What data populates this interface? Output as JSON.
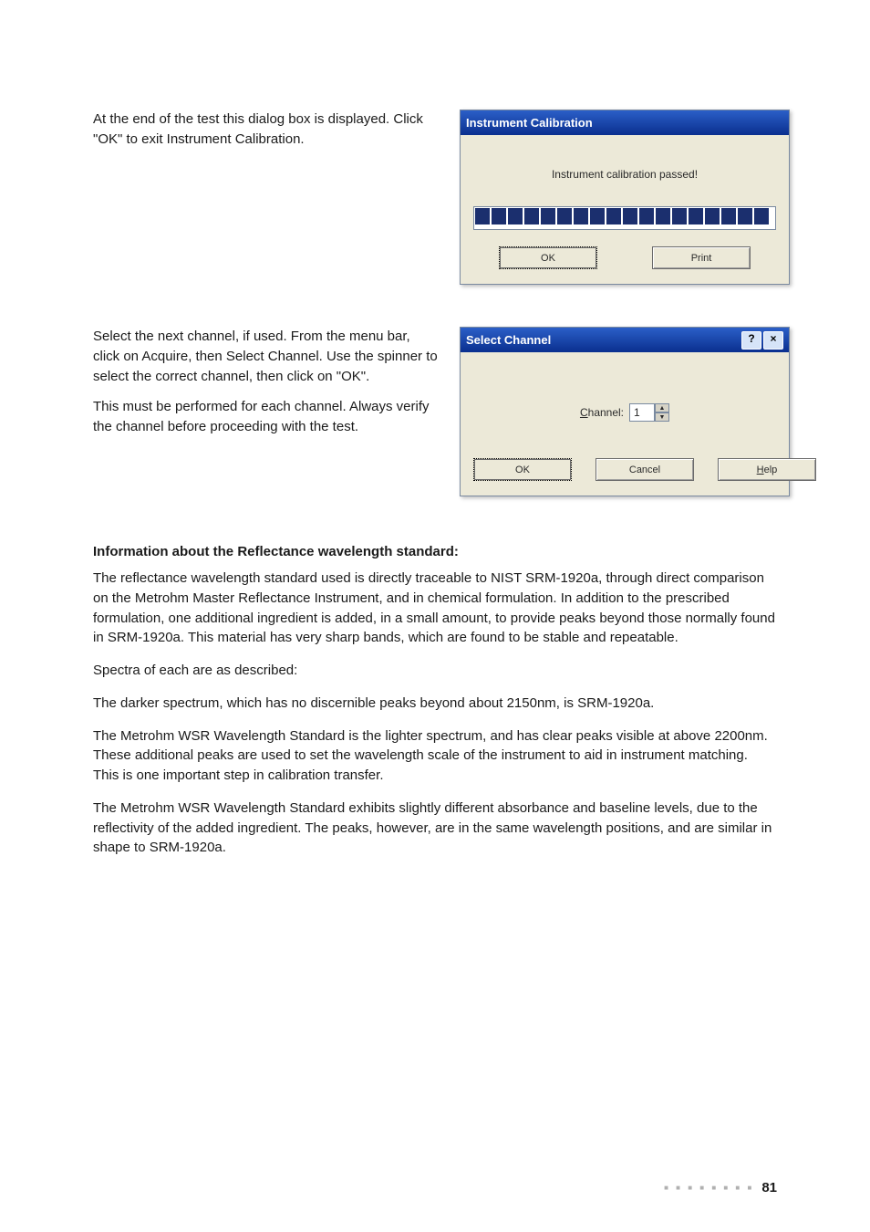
{
  "section1": {
    "p1": "At the end of the test this dialog box is displayed. Click \"OK\" to exit Instrument Calibration."
  },
  "dialog1": {
    "title": "Instrument Calibration",
    "message": "Instrument calibration passed!",
    "progress_blocks": 18,
    "buttons": {
      "ok": "OK",
      "print": "Print"
    }
  },
  "section2": {
    "p1": "Select the next channel, if used. From the menu bar, click on Acquire, then Select Channel. Use the spinner to select the correct channel, then click on \"OK\".",
    "p2": "This must be performed for each channel. Always verify the channel before proceeding with the test."
  },
  "dialog2": {
    "title": "Select Channel",
    "help_btn": "?",
    "close_btn": "×",
    "channel_label_prefix": "C",
    "channel_label_rest": "hannel:",
    "channel_value": "1",
    "buttons": {
      "ok": "OK",
      "cancel": "Cancel",
      "help_prefix": "H",
      "help_rest": "elp"
    }
  },
  "info": {
    "heading": "Information about the Reflectance wavelength standard:",
    "p1": "The reflectance wavelength standard used is directly traceable to NIST SRM-1920a, through direct comparison on the Metrohm Master Reflectance Instrument, and in chemical formulation. In addition to the prescribed formulation, one additional ingredient is added, in a small amount, to provide peaks beyond those normally found in SRM-1920a. This material has very sharp bands, which are found to be stable and repeatable.",
    "p2": "Spectra of each are as described:",
    "p3": "The darker spectrum, which has no discernible peaks beyond about 2150nm, is SRM-1920a.",
    "p4": "The Metrohm WSR Wavelength Standard is the lighter spectrum, and has clear peaks visible at above 2200nm. These additional peaks are used to set the wavelength scale of the instrument to aid in instrument matching. This is one important step in calibration transfer.",
    "p5": "The Metrohm WSR Wavelength Standard exhibits slightly different absorbance and baseline levels, due to the reflectivity of the added ingredient. The peaks, however, are in the same wavelength positions, and are similar in shape to SRM-1920a."
  },
  "footer": {
    "page_number": "81"
  }
}
